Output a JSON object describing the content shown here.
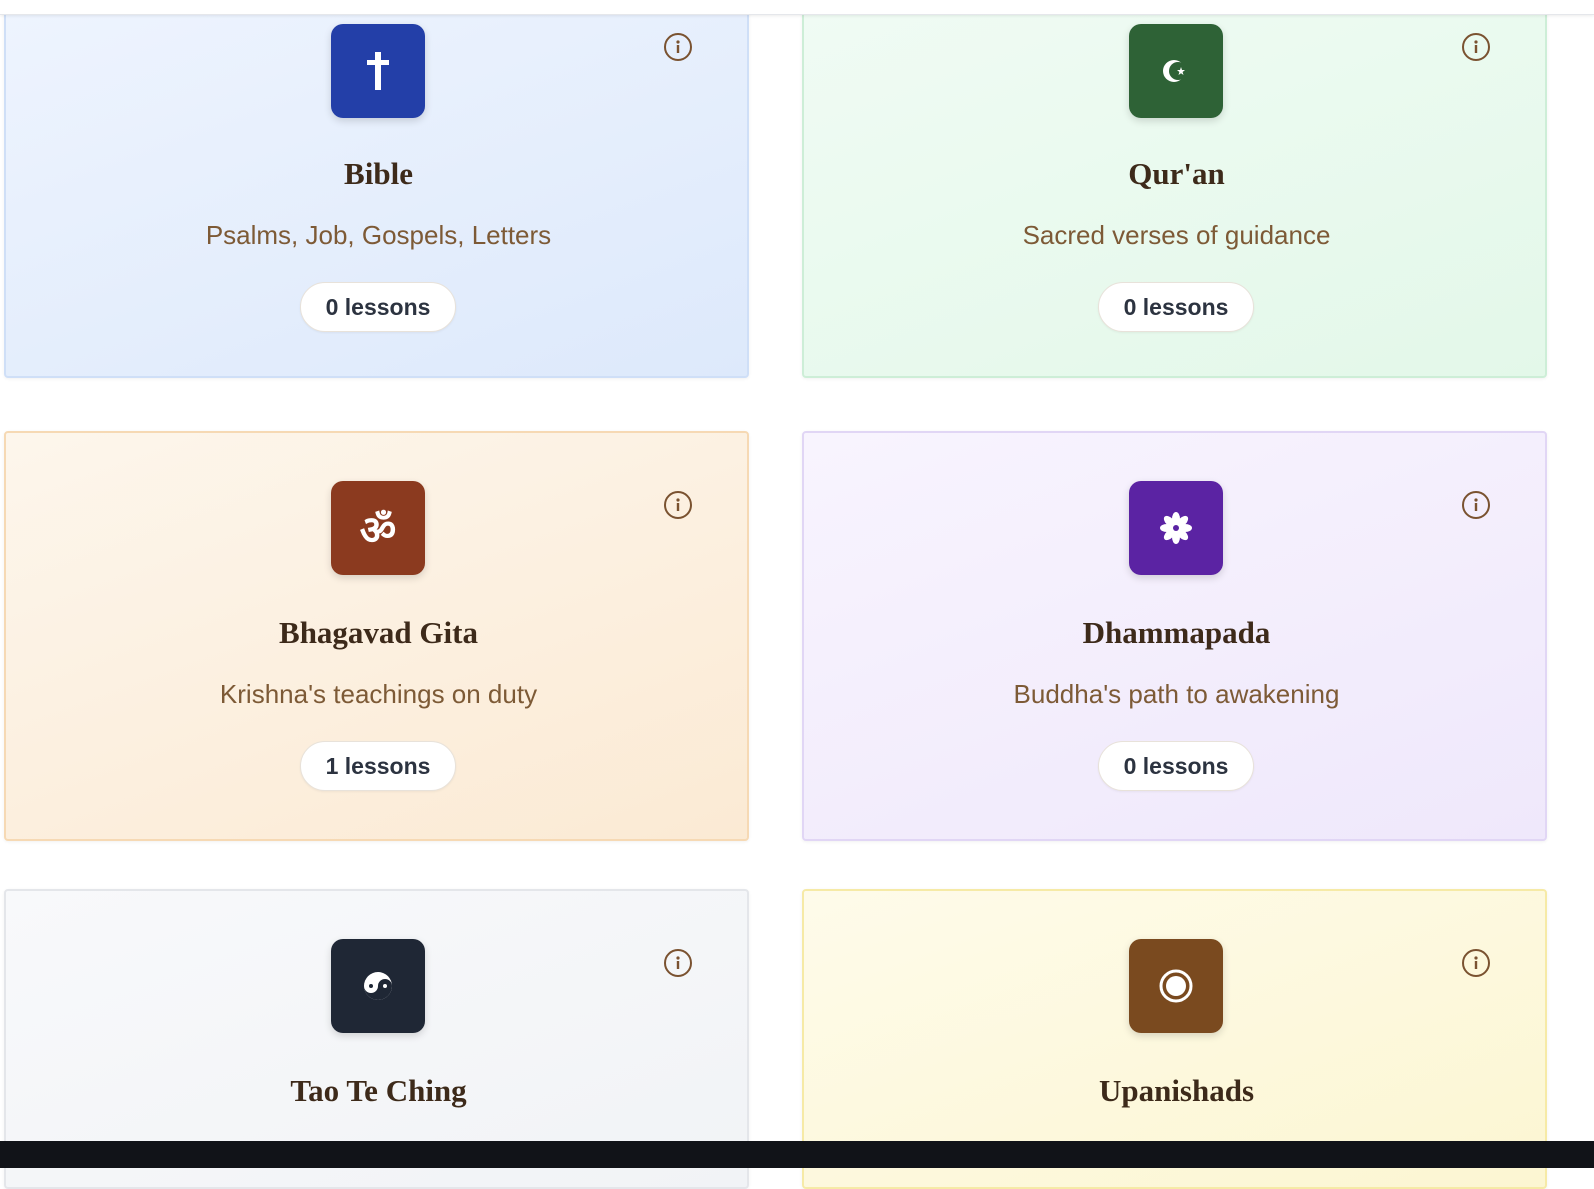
{
  "colors": {
    "bible_icon": "#233fa8",
    "quran_icon": "#2e6236",
    "gita_icon": "#8b3a1f",
    "dhammapada_icon": "#5b23a3",
    "tao_icon": "#1f2735",
    "upanishads_icon": "#7a4a1f",
    "title_text": "#3d2a1a",
    "subtitle_text": "#7d5a36",
    "info_icon": "#7a5230"
  },
  "cards": [
    {
      "title": "Bible",
      "subtitle": "Psalms, Job, Gospels, Letters",
      "lessons": "0 lessons",
      "icon": "cross-icon"
    },
    {
      "title": "Qur'an",
      "subtitle": "Sacred verses of guidance",
      "lessons": "0 lessons",
      "icon": "crescent-star-icon"
    },
    {
      "title": "Bhagavad Gita",
      "subtitle": "Krishna's teachings on duty",
      "lessons": "1 lessons",
      "icon": "om-icon"
    },
    {
      "title": "Dhammapada",
      "subtitle": "Buddha's path to awakening",
      "lessons": "0 lessons",
      "icon": "dharma-flower-icon"
    },
    {
      "title": "Tao Te Ching",
      "icon": "yin-yang-icon"
    },
    {
      "title": "Upanishads",
      "icon": "circle-dot-icon"
    }
  ]
}
